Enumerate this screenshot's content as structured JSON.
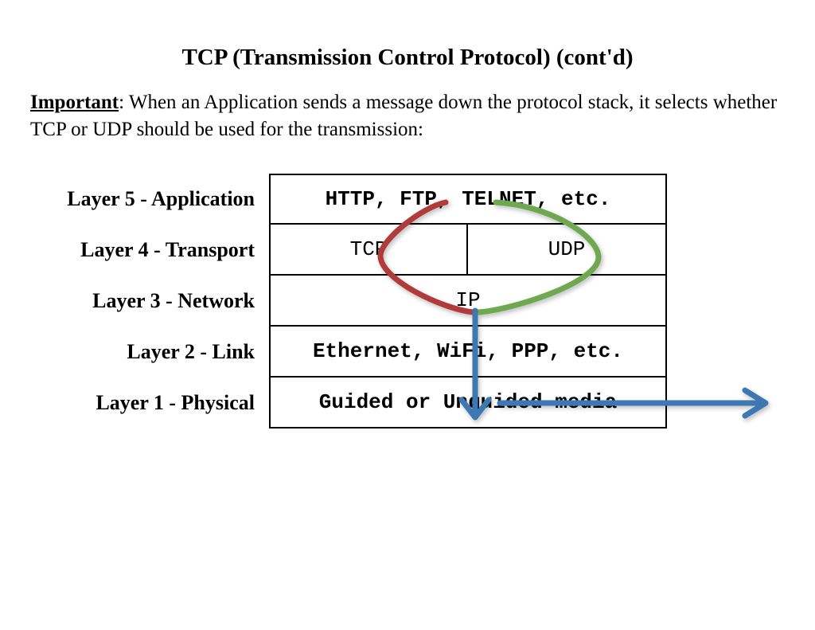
{
  "title": "TCP (Transmission Control Protocol) (cont'd)",
  "important_label": "Important",
  "important_colon": ":",
  "important_text": " When an Application sends a message down the protocol stack, it selects whether TCP or UDP should be used for the transmission:",
  "layers": {
    "l5": {
      "label": "Layer 5 - Application",
      "content": "HTTP, FTP, TELNET, etc."
    },
    "l4": {
      "label": "Layer 4 - Transport",
      "left": "TCP",
      "right": "UDP"
    },
    "l3": {
      "label": "Layer 3 - Network",
      "content": "IP"
    },
    "l2": {
      "label": "Layer 2 - Link",
      "content": "Ethernet, WiFi, PPP, etc."
    },
    "l1": {
      "label": "Layer 1 - Physical",
      "content": "Guided or Unguided media"
    }
  },
  "annotations": {
    "red_curve": "application-to-tcp-path",
    "green_curve": "application-to-udp-path",
    "blue_arrow_down": "stack-flow-down",
    "blue_arrow_right": "to-media-out"
  },
  "colors": {
    "red": "#B13A3B",
    "green": "#6FA84F",
    "blue": "#3E78B3"
  }
}
